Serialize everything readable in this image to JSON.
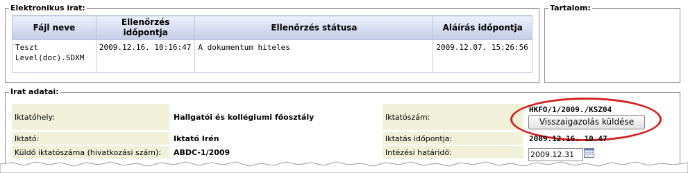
{
  "elektronikus_irat": {
    "legend": "Elektronikus irat:",
    "headers": [
      "Fájl neve",
      "Ellenőrzés időpontja",
      "Ellenőrzés státusa",
      "Aláírás időpontja"
    ],
    "rows": [
      [
        "Teszt Level(doc).SDXM",
        "2009.12.16. 10:16:47",
        "A dokumentum hiteles",
        "2009.12.07. 15:26:56"
      ]
    ]
  },
  "tartalom": {
    "legend": "Tartalom:"
  },
  "irat_adatai": {
    "legend": "Irat adatai:",
    "iktatohely_label": "Iktatóhely:",
    "iktatohely_value": "Hallgatói és kollégiumi főosztály",
    "iktatoszam_label": "Iktatószám:",
    "iktatoszam_value": "HKFO/1/2009./KSZ04",
    "button_label": "Visszaigazolás küldése",
    "iktato_label": "Iktató:",
    "iktato_value": "Iktató Irén",
    "iktatas_label": "Iktatás időpontja:",
    "iktatas_value": "2009.12.16. 10.47",
    "kuldo_label": "Küldő iktatószáma (hivatkozási szám):",
    "kuldo_value": "ABDC-1/2009",
    "hatarido_label": "Intézési határidő:",
    "hatarido_value": "2009.12.31"
  },
  "colors": {
    "highlight_ellipse": "#d51f1f",
    "label_bg": "#f0f1d8",
    "header_bg": "#c4cbe6"
  },
  "icons": {
    "calendar": "calendar-icon"
  }
}
